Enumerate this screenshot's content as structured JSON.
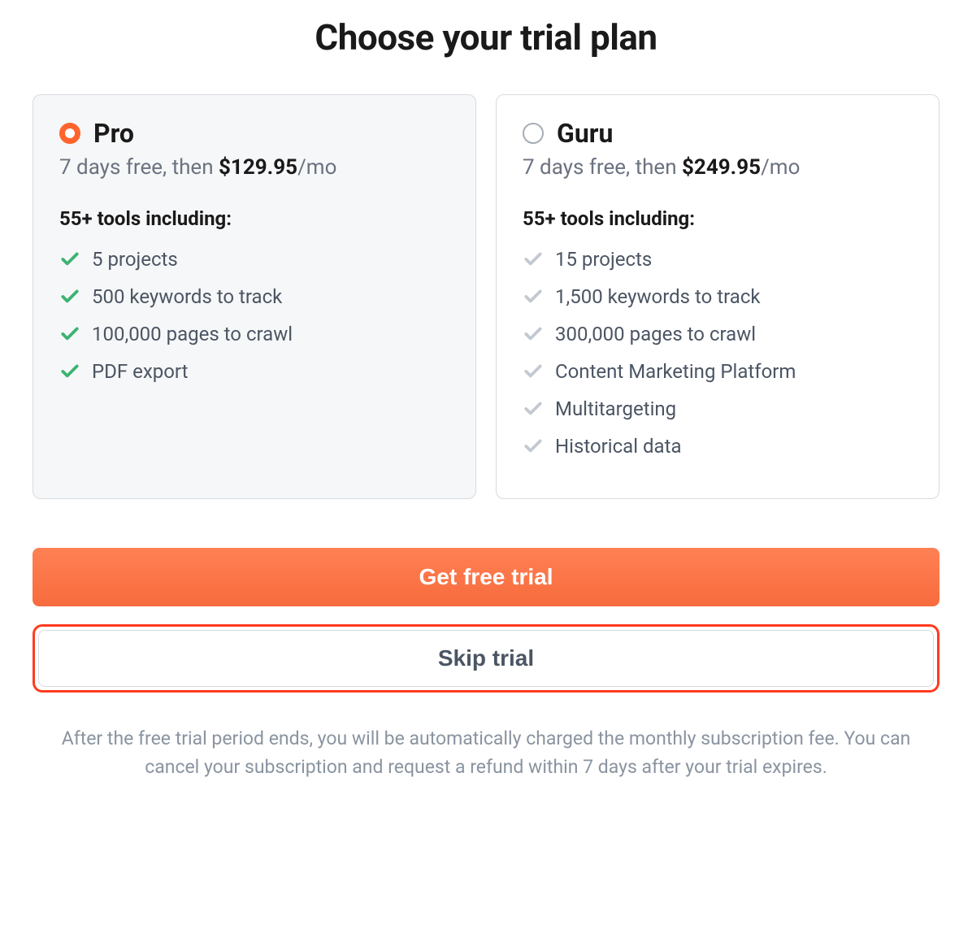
{
  "title": "Choose your trial plan",
  "plans": [
    {
      "id": "pro",
      "name": "Pro",
      "selected": true,
      "price_prefix": "7 days free, then ",
      "price_amount": "$129.95",
      "price_suffix": "/mo",
      "tools_heading": "55+ tools including:",
      "features": [
        "5 projects",
        "500 keywords to track",
        "100,000 pages to crawl",
        "PDF export"
      ]
    },
    {
      "id": "guru",
      "name": "Guru",
      "selected": false,
      "price_prefix": "7 days free, then ",
      "price_amount": "$249.95",
      "price_suffix": "/mo",
      "tools_heading": "55+ tools including:",
      "features": [
        "15 projects",
        "1,500 keywords to track",
        "300,000 pages to crawl",
        "Content Marketing Platform",
        "Multitargeting",
        "Historical data"
      ]
    }
  ],
  "buttons": {
    "primary": "Get free trial",
    "secondary": "Skip trial"
  },
  "disclaimer": "After the free trial period ends, you will be automatically charged the monthly subscription fee. You can cancel your subscription and request a refund within 7 days after your trial expires.",
  "colors": {
    "accent": "#ff642d",
    "check_active": "#3cb371",
    "check_inactive": "#c3c9d1"
  }
}
